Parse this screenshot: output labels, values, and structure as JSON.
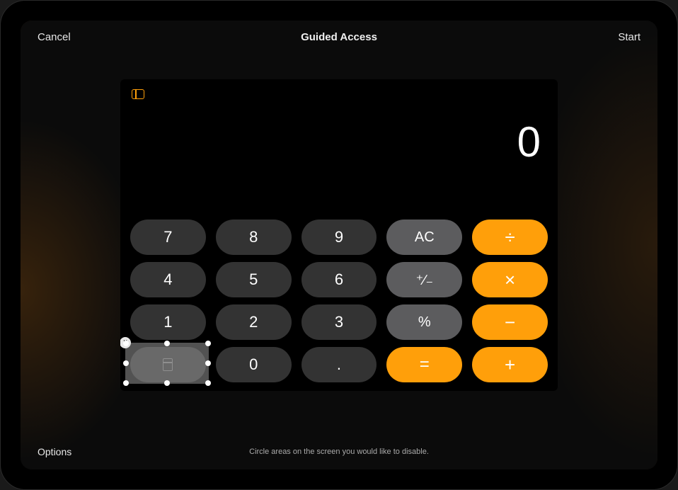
{
  "header": {
    "cancel_label": "Cancel",
    "title": "Guided Access",
    "start_label": "Start"
  },
  "footer": {
    "options_label": "Options",
    "hint": "Circle areas on the screen you would like to disable."
  },
  "calculator": {
    "display": "0",
    "keys": {
      "r0": [
        "7",
        "8",
        "9",
        "AC",
        "÷"
      ],
      "r1": [
        "4",
        "5",
        "6",
        "⁺∕₋",
        "×"
      ],
      "r2": [
        "1",
        "2",
        "3",
        "%",
        "−"
      ],
      "r3": [
        "",
        "0",
        ".",
        "=",
        "+"
      ]
    }
  },
  "colors": {
    "operator": "#ff9f0a",
    "function": "#5c5c5e",
    "number": "#333333"
  }
}
